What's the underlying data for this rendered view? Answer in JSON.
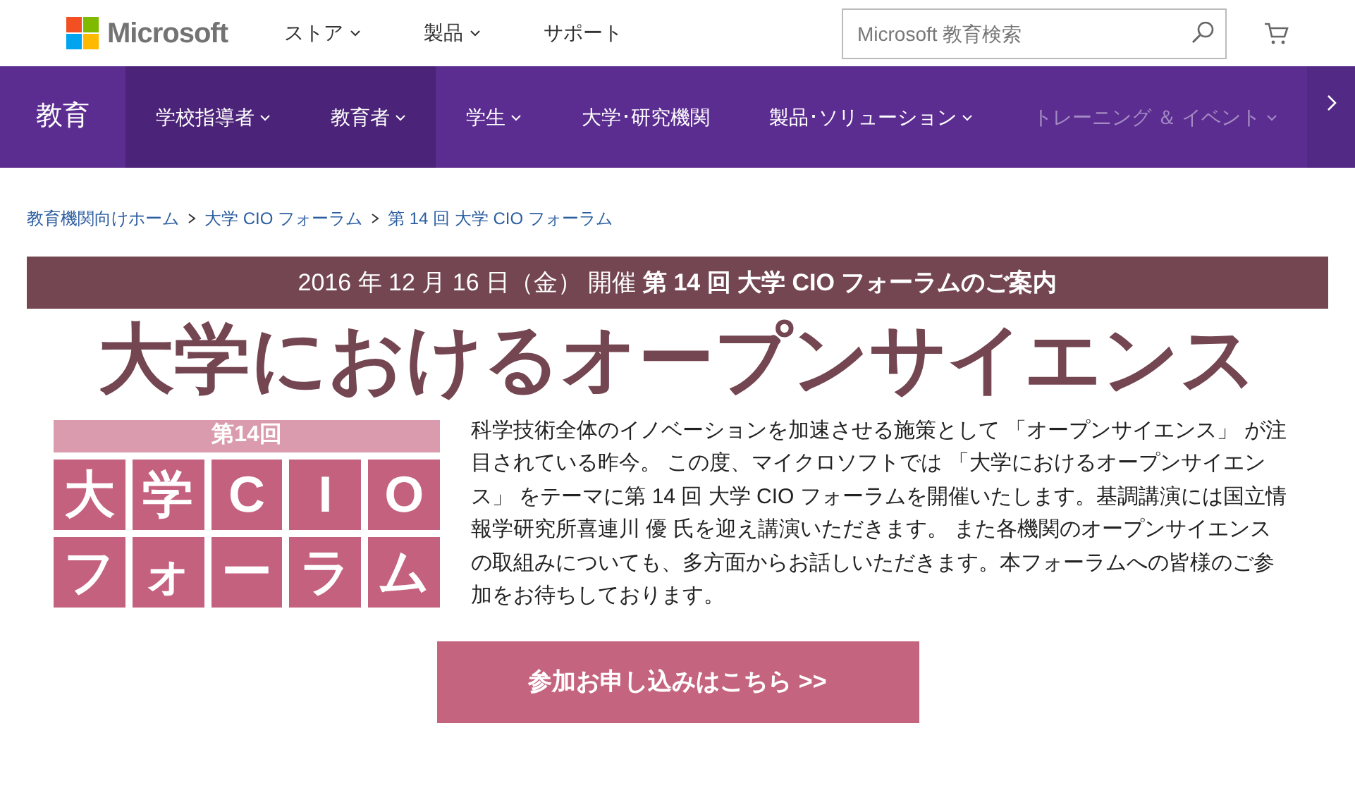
{
  "header": {
    "brand": "Microsoft",
    "menu": [
      {
        "label": "ストア",
        "has_menu": true
      },
      {
        "label": "製品",
        "has_menu": true
      },
      {
        "label": "サポート",
        "has_menu": false
      }
    ],
    "search": {
      "placeholder": "Microsoft 教育検索"
    }
  },
  "nav": {
    "title": "教育",
    "items": [
      {
        "label": "学校指導者",
        "has_menu": true,
        "highlighted": true,
        "faded": false
      },
      {
        "label": "教育者",
        "has_menu": true,
        "highlighted": true,
        "faded": false
      },
      {
        "label": "学生",
        "has_menu": true,
        "highlighted": false,
        "faded": false
      },
      {
        "label": "大学･研究機関",
        "has_menu": false,
        "highlighted": false,
        "faded": false
      },
      {
        "label": "製品･ソリューション",
        "has_menu": true,
        "highlighted": false,
        "faded": false
      },
      {
        "label": "トレーニング ＆ イベント",
        "has_menu": true,
        "highlighted": false,
        "faded": true
      }
    ]
  },
  "breadcrumb": [
    "教育機関向けホーム",
    "大学 CIO フォーラム",
    "第 14 回 大学 CIO フォーラム"
  ],
  "banner": "2016 年 12 月 16 日（金） 開催 **第 14 回 大学 CIO フォーラムのご案内**",
  "headline": "大学におけるオープンサイエンス",
  "logo": {
    "top": "第14回",
    "tiles": [
      "大",
      "学",
      "C",
      "I",
      "O",
      "フ",
      "ォ",
      "ー",
      "ラ",
      "ム"
    ]
  },
  "description": "科学技術全体のイノベーションを加速させる施策として 「オープンサイエンス」 が注目されている昨今。 この度、マイクロソフトでは 「大学におけるオープンサイエンス」 をテーマに第 14 回 大学 CIO フォーラムを開催いたします。基調講演には国立情報学研究所喜連川 優 氏を迎え講演いただきます。 また各機関のオープンサイエンスの取組みについても、多方面からお話しいただきます。本フォーラムへの皆様のご参加をお待ちしております。",
  "cta": "参加お申し込みはこちら >>"
}
